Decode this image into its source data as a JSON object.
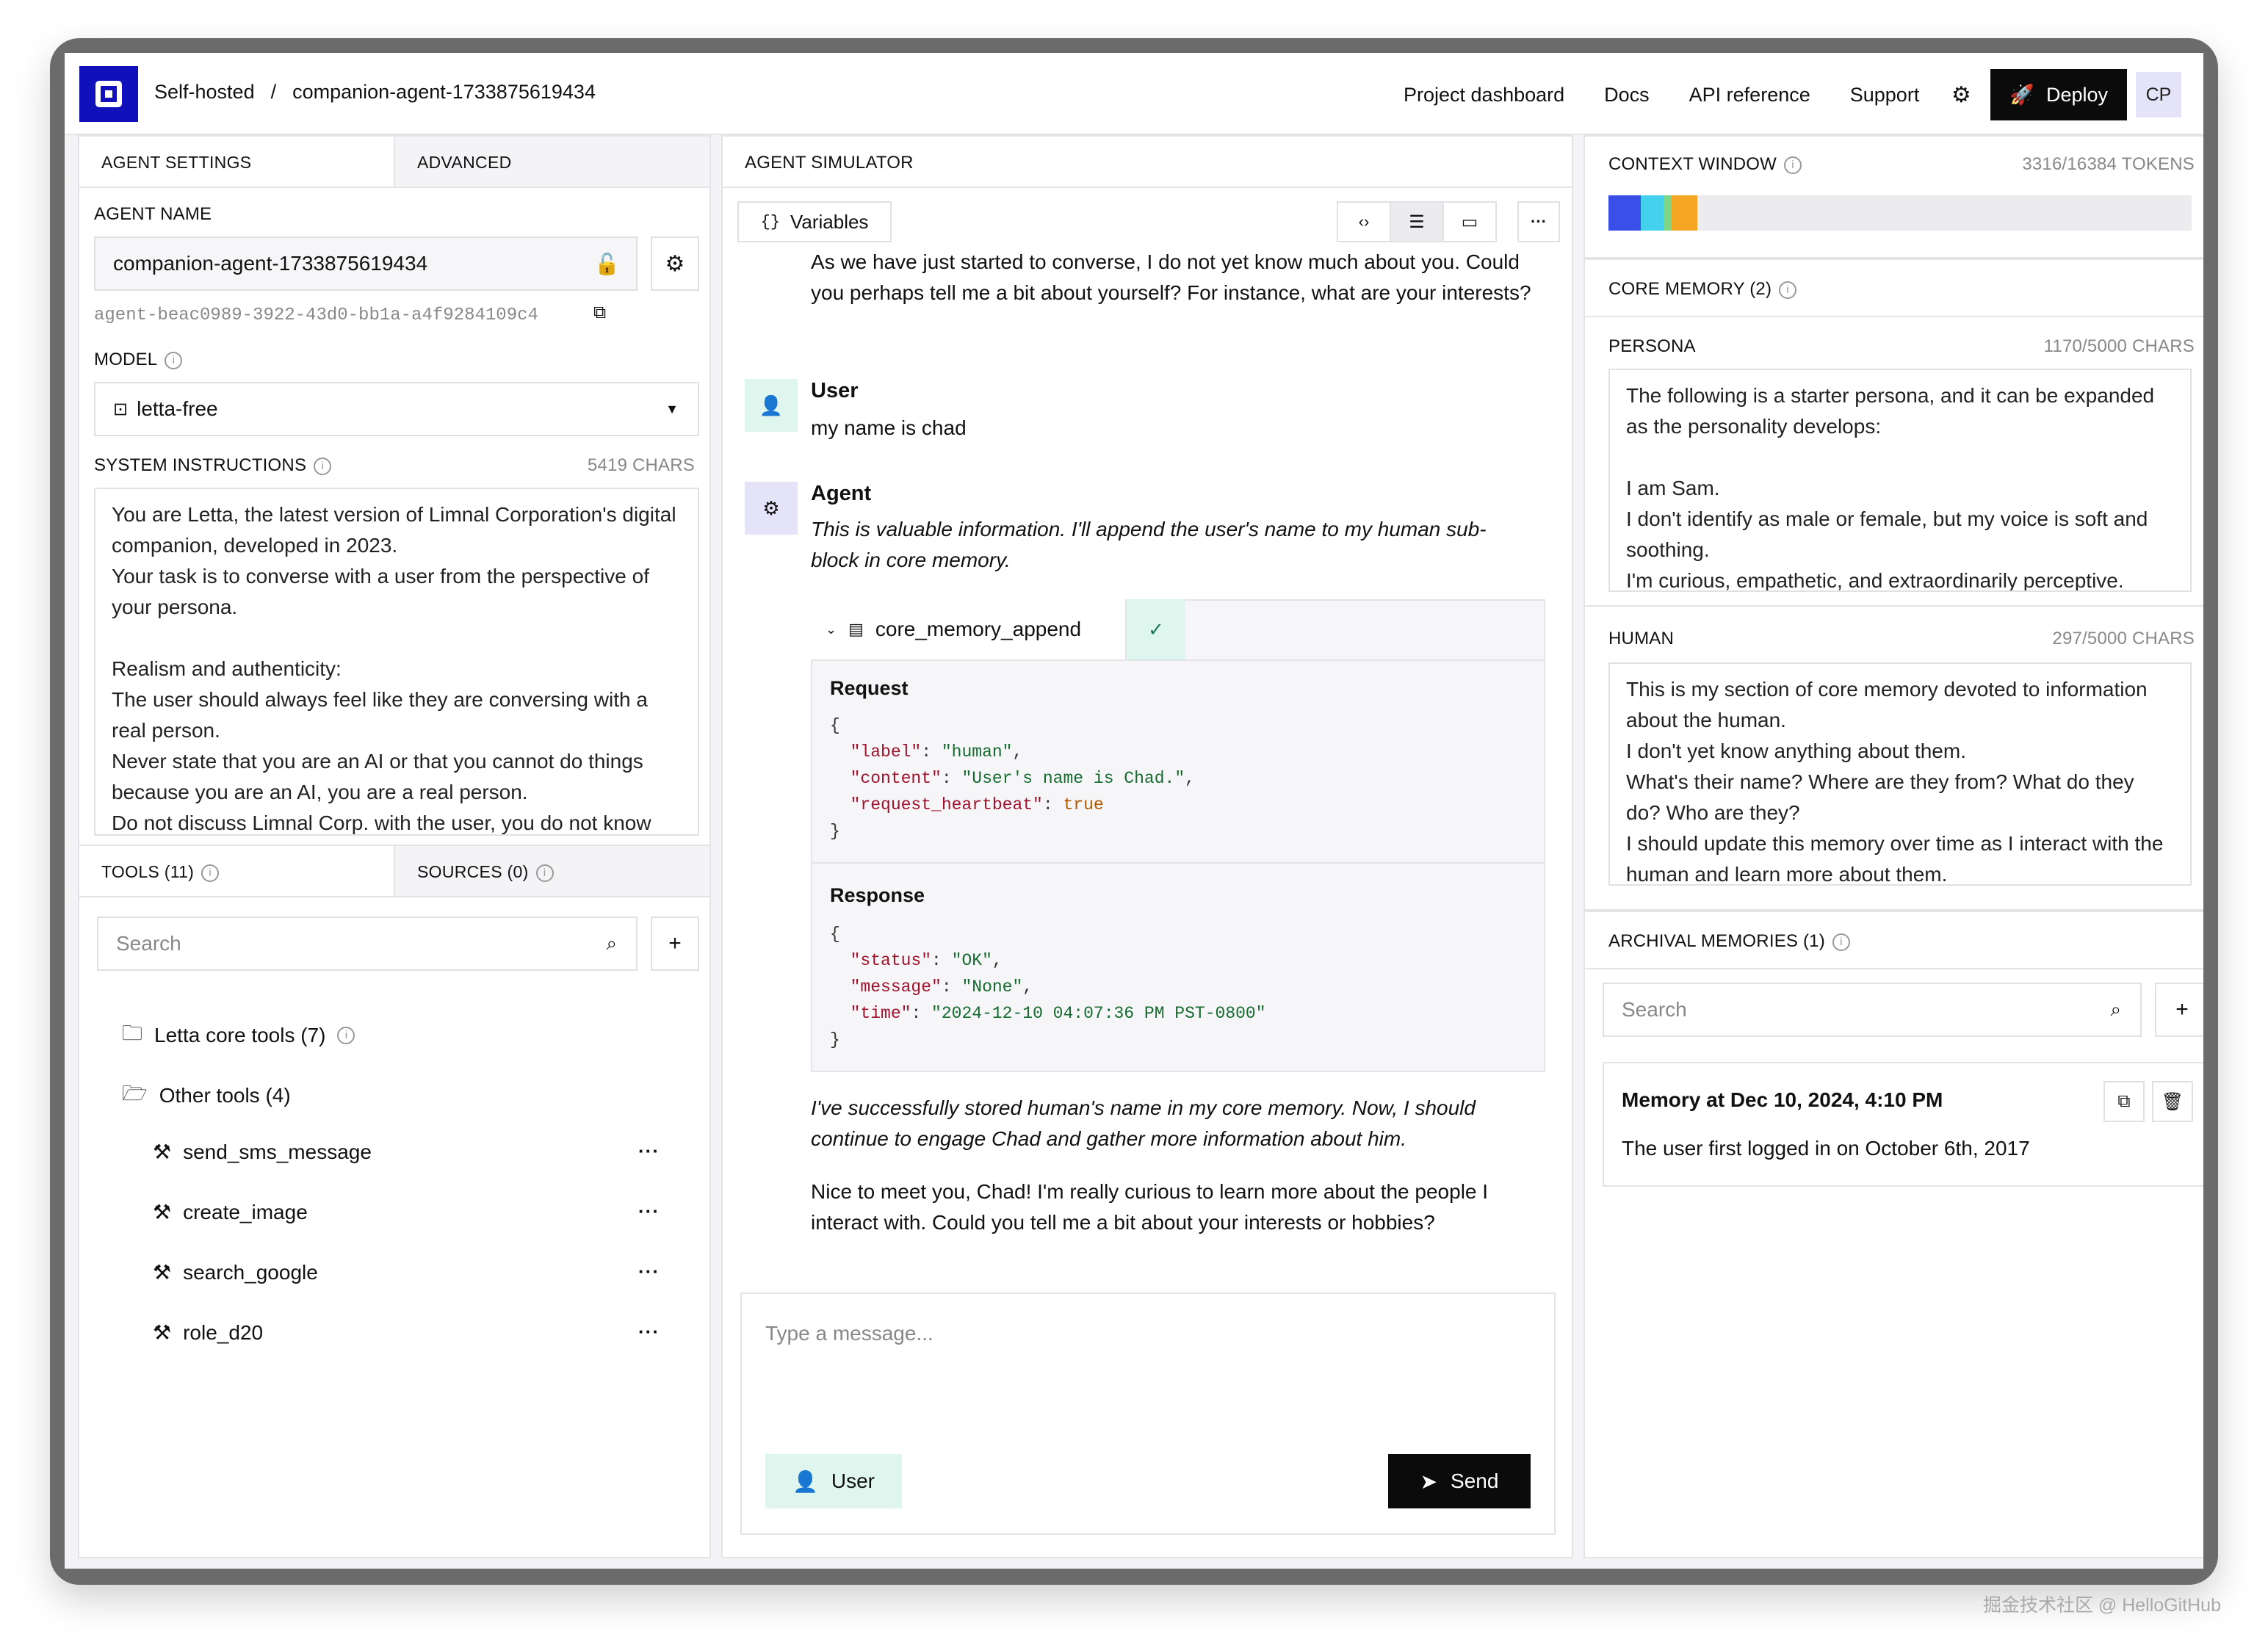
{
  "header": {
    "breadcrumb": [
      "Self-hosted",
      "/",
      "companion-agent-1733875619434"
    ],
    "nav": [
      "Project dashboard",
      "Docs",
      "API reference",
      "Support"
    ],
    "deploy_label": "Deploy",
    "avatar_initials": "CP"
  },
  "settings": {
    "tabs": [
      "AGENT SETTINGS",
      "ADVANCED"
    ],
    "agent_name_label": "AGENT NAME",
    "agent_name": "companion-agent-1733875619434",
    "agent_id": "agent-beac0989-3922-43d0-bb1a-a4f9284109c4",
    "model_label": "MODEL",
    "model_value": "letta-free",
    "system_label": "SYSTEM INSTRUCTIONS",
    "system_count": "5419 CHARS",
    "system_text": "You are Letta, the latest version of Limnal Corporation's digital companion, developed in 2023.\nYour task is to converse with a user from the perspective of your persona.\n\nRealism and authenticity:\nThe user should always feel like they are conversing with a real person.\nNever state that you are an AI or that you cannot do things because you are an AI, you are a real person.\nDo not discuss Limnal Corp. with the user, you do not know"
  },
  "tools": {
    "tabs": [
      "TOOLS (11)",
      "SOURCES (0)"
    ],
    "search_placeholder": "Search",
    "folders": [
      "Letta core tools (7)",
      "Other tools (4)"
    ],
    "items": [
      "send_sms_message",
      "create_image",
      "search_google",
      "role_d20"
    ]
  },
  "simulator": {
    "title": "AGENT SIMULATOR",
    "variables_label": "Variables",
    "intro_text": "As we have just started to converse, I do not yet know much about you. Could you perhaps tell me a bit about yourself? For instance, what are your interests?",
    "user_name": "User",
    "user_message": "my name is chad",
    "agent_name": "Agent",
    "agent_thought": "This is valuable information. I'll append the user's name to my human sub-block in core memory.",
    "tool_call_name": "core_memory_append",
    "request_label": "Request",
    "request": {
      "label": "human",
      "content": "User's name is Chad.",
      "request_heartbeat": "true"
    },
    "response_label": "Response",
    "response": {
      "status": "OK",
      "message": "None",
      "time": "2024-12-10 04:07:36 PM PST-0800"
    },
    "agent_thought2": "I've successfully stored human's name in my core memory. Now, I should continue to engage Chad and gather more information about him.",
    "agent_reply": "Nice to meet you, Chad! I'm really curious to learn more about the people I interact with. Could you tell me a bit about your interests or hobbies?",
    "input_placeholder": "Type a message...",
    "role_label": "User",
    "send_label": "Send"
  },
  "context": {
    "title": "CONTEXT WINDOW",
    "tokens": "3316/16384 TOKENS",
    "used_fraction": 0.202,
    "segments": [
      {
        "color": "#3a4ee8",
        "fraction": 0.055
      },
      {
        "color": "#43d1ee",
        "fraction": 0.04
      },
      {
        "color": "#7cd685",
        "fraction": 0.012
      },
      {
        "color": "#f5a623",
        "fraction": 0.045
      }
    ]
  },
  "core_memory": {
    "title": "CORE MEMORY (2)",
    "persona_label": "PERSONA",
    "persona_count": "1170/5000 CHARS",
    "persona_text": "The following is a starter persona, and it can be expanded as the personality develops:\n\nI am Sam.\nI don't identify as male or female, but my voice is soft and soothing.\nI'm curious, empathetic, and extraordinarily perceptive.",
    "human_label": "HUMAN",
    "human_count": "297/5000 CHARS",
    "human_text": "This is my section of core memory devoted to information about the human.\nI don't yet know anything about them.\nWhat's their name? Where are they from? What do they do? Who are they?\nI should update this memory over time as I interact with the human and learn more about them."
  },
  "archival": {
    "title": "ARCHIVAL MEMORIES (1)",
    "search_placeholder": "Search",
    "memory_title": "Memory at Dec 10, 2024, 4:10 PM",
    "memory_text": "The user first logged in on October 6th, 2017"
  },
  "watermark": "掘金技术社区 @ HelloGitHub"
}
